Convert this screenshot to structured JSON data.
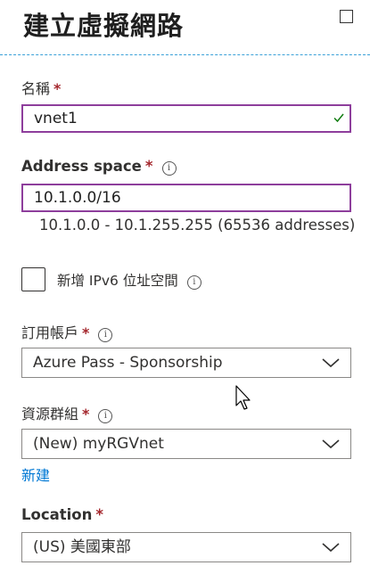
{
  "header": {
    "title": "建立虛擬網路"
  },
  "name_field": {
    "label": "名稱",
    "required_mark": "*",
    "value": "vnet1"
  },
  "address_space": {
    "label": "Address space",
    "required_mark": "*",
    "info_icon": "i",
    "value": "10.1.0.0/16",
    "range_hint": "10.1.0.0 - 10.1.255.255 (65536 addresses)"
  },
  "ipv6": {
    "label": "新增 IPv6 位址空間",
    "info_icon": "i",
    "checked": false
  },
  "subscription": {
    "label": "訂用帳戶",
    "required_mark": "*",
    "info_icon": "i",
    "selected": "Azure Pass - Sponsorship"
  },
  "resource_group": {
    "label": "資源群組",
    "required_mark": "*",
    "info_icon": "i",
    "selected": "(New) myRGVnet",
    "create_new_link": "新建"
  },
  "location": {
    "label": "Location",
    "required_mark": "*",
    "selected": "(US) 美國東部"
  },
  "colors": {
    "accent_border": "#8e3e9c",
    "required": "#a4262c",
    "link": "#0078d4",
    "valid_check": "#107c10",
    "divider": "#3aa0d8"
  },
  "icons": {
    "maximize": "maximize-icon",
    "check": "check-icon",
    "info": "info-icon",
    "chevron": "chevron-down-icon"
  }
}
